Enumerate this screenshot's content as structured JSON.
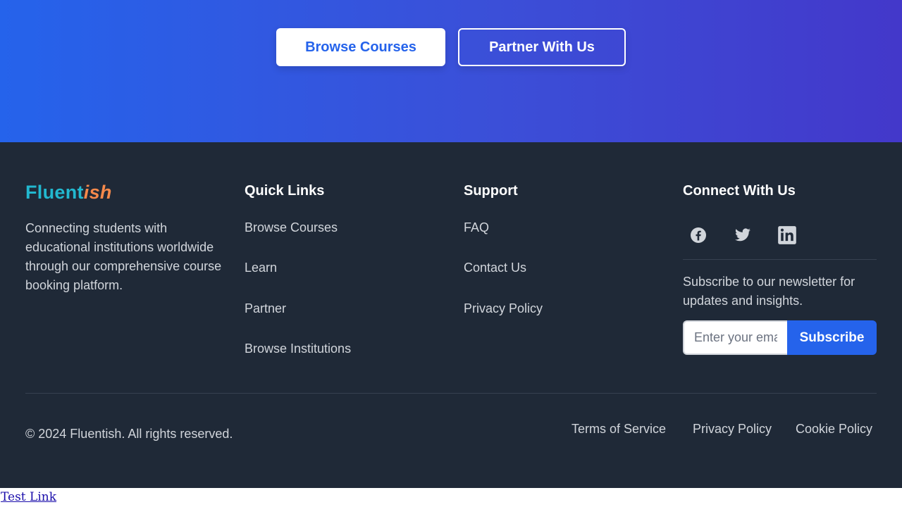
{
  "hero": {
    "browse_label": "Browse Courses",
    "partner_label": "Partner With Us"
  },
  "footer": {
    "brand": {
      "part1": "Fluent",
      "part2": "ish",
      "tagline": "Connecting students with educational institutions worldwide through our comprehensive course booking platform."
    },
    "quick_links": {
      "title": "Quick Links",
      "items": [
        "Browse Courses",
        "Learn",
        "Partner",
        "Browse Institutions"
      ]
    },
    "support": {
      "title": "Support",
      "items": [
        "FAQ",
        "Contact Us",
        "Privacy Policy"
      ]
    },
    "connect": {
      "title": "Connect With Us",
      "icons": [
        "facebook-icon",
        "twitter-icon",
        "linkedin-icon"
      ],
      "newsletter_text": "Subscribe to our newsletter for updates and insights.",
      "email_placeholder": "Enter your email",
      "subscribe_label": "Subscribe"
    },
    "copyright": "© 2024 Fluentish. All rights reserved.",
    "legal": [
      "Terms of Service",
      "Privacy Policy",
      "Cookie Policy"
    ]
  },
  "test_link": "Test Link",
  "colors": {
    "accent": "#2563eb",
    "footer_bg": "#1f2937",
    "brand_teal": "#22b8cf",
    "brand_orange": "#f6894b"
  }
}
